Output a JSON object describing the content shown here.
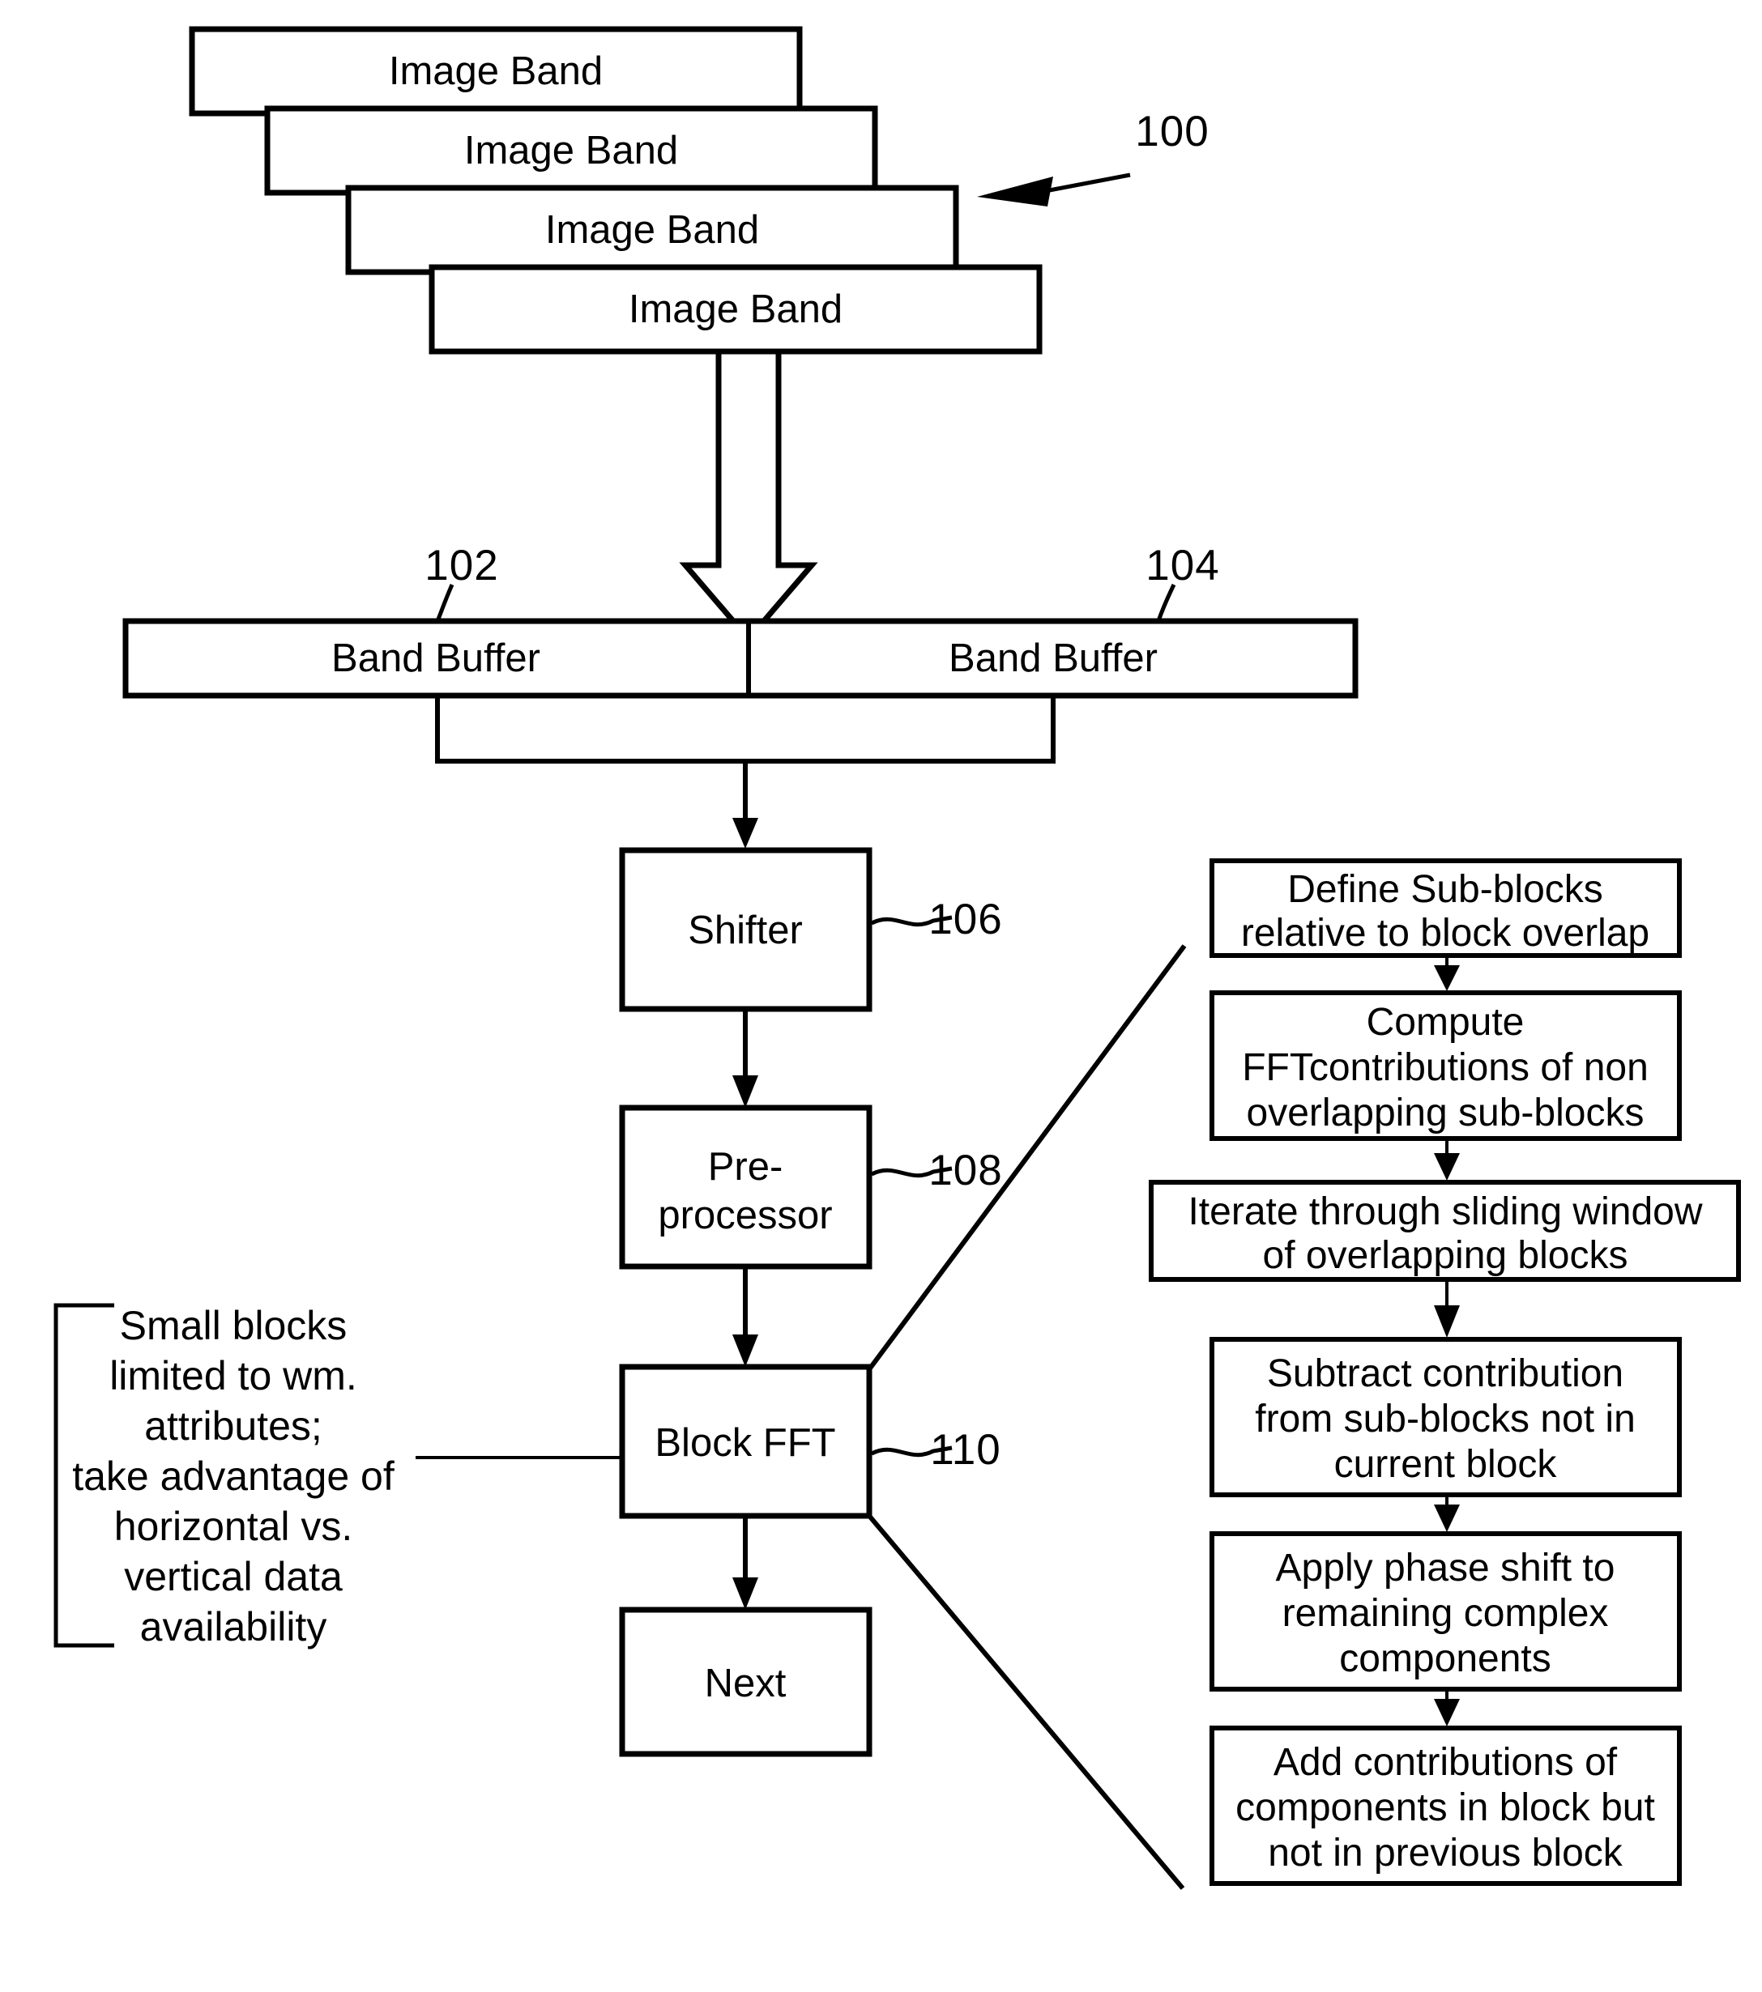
{
  "figure": {
    "title": "Block FFT pipeline diagram",
    "reference_numerals": {
      "system": "100",
      "band_buffer_left": "102",
      "band_buffer_right": "104",
      "shifter": "106",
      "preprocessor": "108",
      "block_fft": "110"
    }
  },
  "image_bands": [
    {
      "label": "Image Band"
    },
    {
      "label": "Image Band"
    },
    {
      "label": "Image Band"
    },
    {
      "label": "Image Band"
    }
  ],
  "band_buffers": [
    {
      "label": "Band Buffer",
      "numeral": "102"
    },
    {
      "label": "Band Buffer",
      "numeral": "104"
    }
  ],
  "pipeline": [
    {
      "label": "Shifter",
      "numeral": "106"
    },
    {
      "label_line1": "Pre-",
      "label_line2": "processor",
      "numeral": "108"
    },
    {
      "label": "Block FFT",
      "numeral": "110"
    },
    {
      "label": "Next",
      "numeral": ""
    }
  ],
  "annotation": {
    "lines": [
      "Small blocks",
      "limited to wm.",
      "attributes;",
      "take advantage of",
      "horizontal vs.",
      "vertical data",
      "availability"
    ]
  },
  "flowchart": [
    {
      "lines": [
        "Define Sub-blocks",
        "relative to block overlap"
      ]
    },
    {
      "lines": [
        "Compute",
        "FFTcontributions of non",
        "overlapping sub-blocks"
      ]
    },
    {
      "lines": [
        "Iterate through sliding window",
        "of overlapping blocks"
      ]
    },
    {
      "lines": [
        "Subtract contribution",
        "from sub-blocks not in",
        "current block"
      ]
    },
    {
      "lines": [
        "Apply phase shift to",
        "remaining complex",
        "components"
      ]
    },
    {
      "lines": [
        "Add contributions of",
        "components in block but",
        "not in previous block"
      ]
    }
  ],
  "colors": {
    "stroke": "#000000",
    "fill": "#ffffff"
  }
}
